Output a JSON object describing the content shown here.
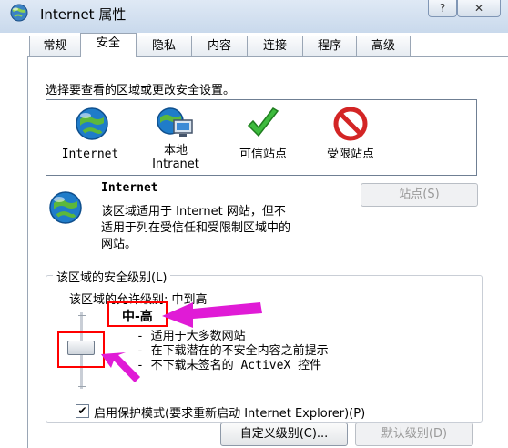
{
  "window": {
    "title": "Internet 属性",
    "help_label": "?",
    "close_label": "✕"
  },
  "tabs": [
    {
      "label": "常规"
    },
    {
      "label": "安全",
      "active": true
    },
    {
      "label": "隐私"
    },
    {
      "label": "内容"
    },
    {
      "label": "连接"
    },
    {
      "label": "程序"
    },
    {
      "label": "高级"
    }
  ],
  "security": {
    "instruction": "选择要查看的区域或更改安全设置。",
    "zones": [
      {
        "label": "Internet",
        "icon": "globe-icon"
      },
      {
        "label": "本地\nIntranet",
        "icon": "local-intranet-icon"
      },
      {
        "label": "可信站点",
        "icon": "checkmark-icon"
      },
      {
        "label": "受限站点",
        "icon": "restricted-icon"
      }
    ],
    "selected_zone": {
      "name": "Internet",
      "description_lines": [
        "该区域适用于 Internet 网站，但不",
        "适用于列在受信任和受限制区域中的",
        "网站。"
      ],
      "sites_button_label": "站点(S)"
    },
    "level_group": {
      "title": "该区域的安全级别(L)",
      "allowed_levels_label": "该区域的允许级别: 中到高",
      "level_name": "中-高",
      "level_fraction": 0.5,
      "bullets": [
        "- 适用于大多数网站",
        "- 在下载潜在的不安全内容之前提示",
        "- 不下载未签名的 ActiveX 控件"
      ],
      "protected_mode_label": "启用保护模式(要求重新启动 Internet Explorer)(P)",
      "protected_mode_checked": true,
      "custom_level_button": "自定义级别(C)...",
      "default_level_button": "默认级别(D)"
    }
  },
  "colors": {
    "annotation": "#e01bd6",
    "highlight_box": "#ff0000"
  }
}
